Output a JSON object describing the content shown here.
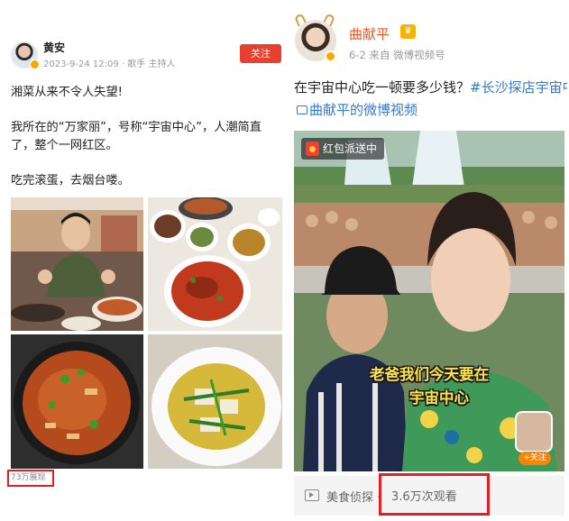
{
  "left_post": {
    "author": "黄安",
    "meta": "2023-9-24 12:09 · 歌手 主持人",
    "follow_label": "关注",
    "paragraphs": [
      "湘菜从来不令人失望!",
      "我所在的“万家丽”，号称“宇宙中心”，人潮简直了，整个一网红区。",
      "吃完滚蛋，去烟台喽。"
    ],
    "images": [
      "man-giving-thumbs-up",
      "table-of-dishes",
      "stir-fried-dish-in-wok",
      "tofu-in-broth"
    ],
    "views": "73万展现"
  },
  "right_post": {
    "author": "曲献平",
    "meta": "6-2 来自 微博视频号",
    "title_plain": "在宇宙中心吃一顿要多少钱？",
    "title_tag1": "#长沙探店宇宙中心万家丽#",
    "title_tag2": "曲献平的微博视频",
    "video": {
      "badge": "红包派送中",
      "subtitle_line1": "老爸我们今天要在",
      "subtitle_line2": "宇宙中心",
      "follow_button": "+关注"
    },
    "channel": "美食侦探 ·",
    "views": "3.6万次观看"
  },
  "colors": {
    "follow_red": "#e8402f",
    "highlight_box": "#e31e24",
    "name_orange": "#e8592a",
    "tag_blue": "#3679c9",
    "subtitle_yellow": "#ffe34a"
  }
}
